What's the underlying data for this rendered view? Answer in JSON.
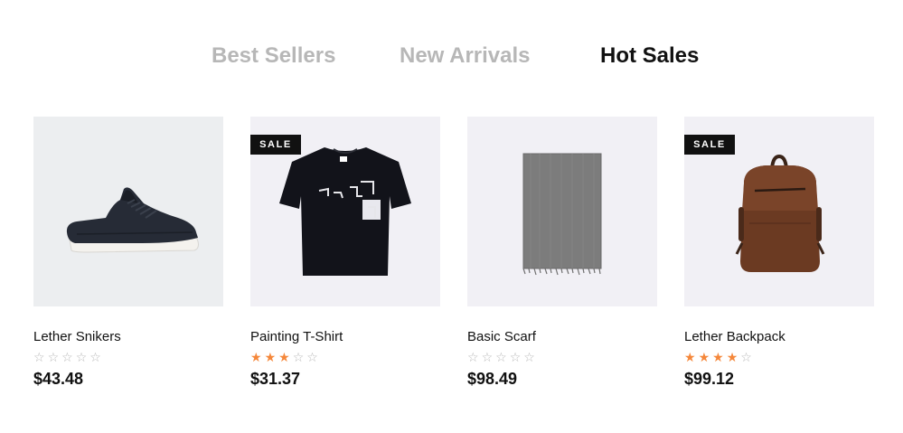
{
  "tabs": [
    {
      "label": "Best Sellers",
      "active": false
    },
    {
      "label": "New Arrivals",
      "active": false
    },
    {
      "label": "Hot Sales",
      "active": true
    }
  ],
  "products": [
    {
      "name": "Lether Snikers",
      "price": "$43.48",
      "rating": 0,
      "sale": false,
      "badge": "",
      "icon": "sneaker-image"
    },
    {
      "name": "Painting T-Shirt",
      "price": "$31.37",
      "rating": 3,
      "sale": true,
      "badge": "SALE",
      "icon": "tshirt-image"
    },
    {
      "name": "Basic Scarf",
      "price": "$98.49",
      "rating": 0,
      "sale": false,
      "badge": "",
      "icon": "scarf-image"
    },
    {
      "name": "Lether Backpack",
      "price": "$99.12",
      "rating": 4,
      "sale": true,
      "badge": "SALE",
      "icon": "backpack-image"
    }
  ],
  "colors": {
    "star_filled": "#f5873a",
    "star_empty": "#b8b8b8",
    "tab_inactive": "#b7b7b7",
    "tab_active": "#111111",
    "badge_bg": "#111111"
  }
}
